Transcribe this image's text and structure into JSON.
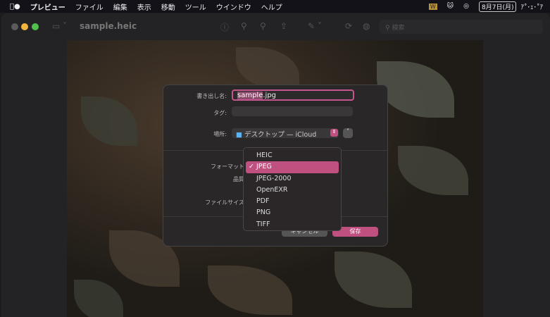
{
  "menubar": {
    "apple": "",
    "items": [
      "プレビュー",
      "ファイル",
      "編集",
      "表示",
      "移動",
      "ツール",
      "ウインドウ",
      "ヘルプ"
    ],
    "date": "8月7日(月)",
    "time": "ｱ˚･ｪ･˚ｱ"
  },
  "window": {
    "title": "sample.heic",
    "search_placeholder": "検索"
  },
  "dialog": {
    "export_label": "書き出し名:",
    "filename_selected": "sample",
    "filename_ext": ".jpg",
    "tag_label": "タグ:",
    "location_label": "場所:",
    "location_value": "デスクトップ — iCloud",
    "format_label": "フォーマット",
    "quality_label": "品質",
    "filesize_label": "ファイルサイズ",
    "cancel": "キャンセル",
    "save": "保存"
  },
  "format_menu": {
    "options": [
      "HEIC",
      "JPEG",
      "JPEG-2000",
      "OpenEXR",
      "PDF",
      "PNG",
      "TIFF"
    ],
    "selected": "JPEG",
    "check": "✓"
  },
  "colors": {
    "accent": "#c0507f"
  }
}
